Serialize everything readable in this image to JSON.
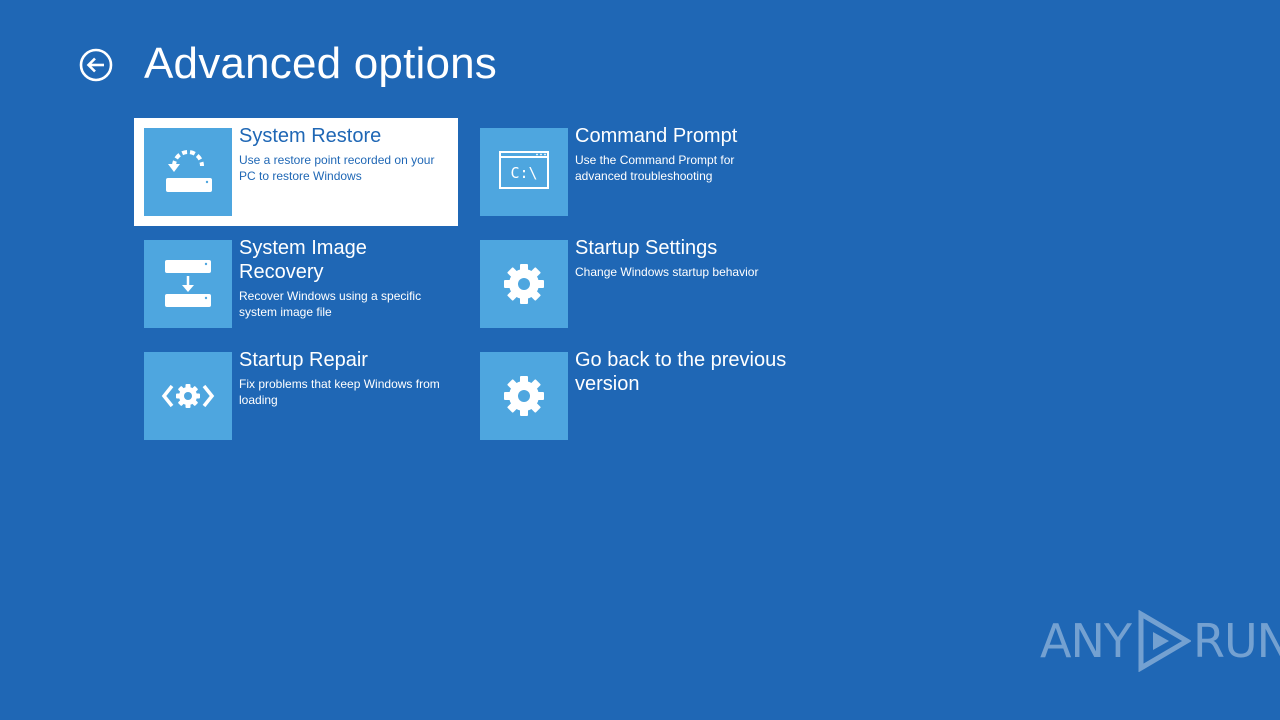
{
  "page": {
    "title": "Advanced options",
    "background": "#1f67b5",
    "tile_color": "#4ea6df"
  },
  "back_button": {
    "icon": "back-arrow-circle-icon"
  },
  "options": [
    {
      "title": "System Restore",
      "description": "Use a restore point recorded on your PC to restore Windows",
      "icon": "system-restore-icon",
      "selected": true
    },
    {
      "title": "Command Prompt",
      "description": "Use the Command Prompt for advanced troubleshooting",
      "icon": "command-prompt-icon",
      "icon_text": "C:\\"
    },
    {
      "title": "System Image Recovery",
      "description": "Recover Windows using a specific system image file",
      "icon": "system-image-recovery-icon"
    },
    {
      "title": "Startup Settings",
      "description": "Change Windows startup behavior",
      "icon": "gear-icon"
    },
    {
      "title": "Startup Repair",
      "description": "Fix problems that keep Windows from loading",
      "icon": "startup-repair-icon"
    },
    {
      "title": "Go back to the previous version",
      "description": "",
      "icon": "gear-icon"
    }
  ],
  "watermark": {
    "left": "ANY",
    "right": "RUN",
    "icon": "play-triangle-icon"
  }
}
